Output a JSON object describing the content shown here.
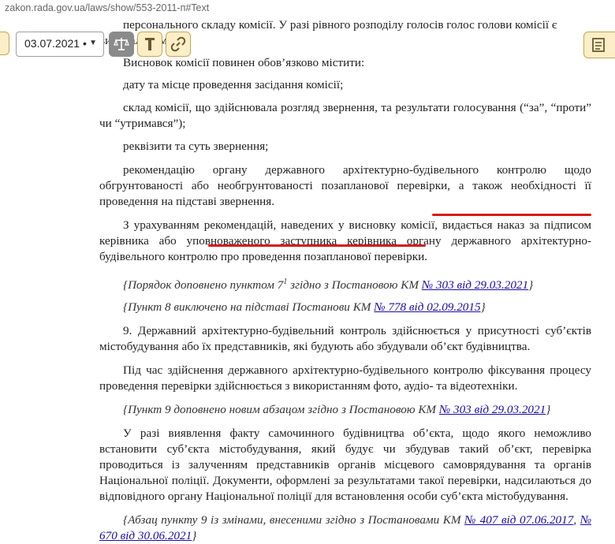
{
  "browser": {
    "url": "zakon.rada.gov.ua/laws/show/553-2011-п#Text"
  },
  "toolbar": {
    "date_value": "03.07.2021 •"
  },
  "document": {
    "p0a": "персонального складу комісії. У разі рівного розподілу голосів голос голови комісії є",
    "p0b": "вирішальним.",
    "p1": "Висновок комісії повинен обов’язково містити:",
    "p2": "дату та місце проведення засідання комісії;",
    "p3": "склад комісії, що здійснювала розгляд звернення, та результати голосування (“за”, “проти” чи “утримався”);",
    "p4": "реквізити та суть звернення;",
    "p5": "рекомендацію органу державного архітектурно-будівельного контролю щодо обгрунтованості або необгрунтованості позапланової перевірки, а також необхідності її проведення на підставі звернення.",
    "p6": "З урахуванням рекомендацій, наведених у висновку комісії, видається наказ за підписом керівника або уповноваженого заступника керівника органу державного архітектурно-будівельного контролю про проведення позапланової перевірки.",
    "n1_pre": "{Порядок доповнено пунктом 7",
    "n1_sup": "1",
    "n1_mid": " згідно з Постановою КМ ",
    "n1_link": "№ 303 від 29.03.2021",
    "n1_post": "}",
    "n2_pre": "{Пункт 8 виключено на підставі Постанови КМ ",
    "n2_link": "№ 778 від 02.09.2015",
    "n2_post": "}",
    "p7": "9. Державний архітектурно-будівельний контроль здійснюється у присутності суб’єктів містобудування або їх представників, які будують або збудували об’єкт будівництва.",
    "p8": "Під час здійснення державного архітектурно-будівельного контролю фіксування процесу проведення перевірки здійснюється з використанням фото, аудіо- та відеотехніки.",
    "n3_pre": "{Пункт 9 доповнено новим абзацом згідно з Постановою КМ ",
    "n3_link": "№ 303 від 29.03.2021",
    "n3_post": "}",
    "p9": "У разі виявлення факту самочинного будівництва об’єкта, щодо якого неможливо встановити суб’єкта містобудування, який будує чи збудував такий об’єкт, перевірка проводиться із залученням представників органів місцевого самоврядування та органів Національної поліції. Документи, оформлені за результатами такої перевірки, надсилаються до відповідного органу Національної поліції для встановлення особи суб’єкта містобудування.",
    "n4_pre": "{Абзац пункту 9 із змінами, внесеними згідно з Постановами КМ ",
    "n4_link1": "№ 407 від 07.06.2017",
    "n4_sep": ", ",
    "n4_link2": "№ 670 від 30.06.2021",
    "n4_post": "}"
  }
}
